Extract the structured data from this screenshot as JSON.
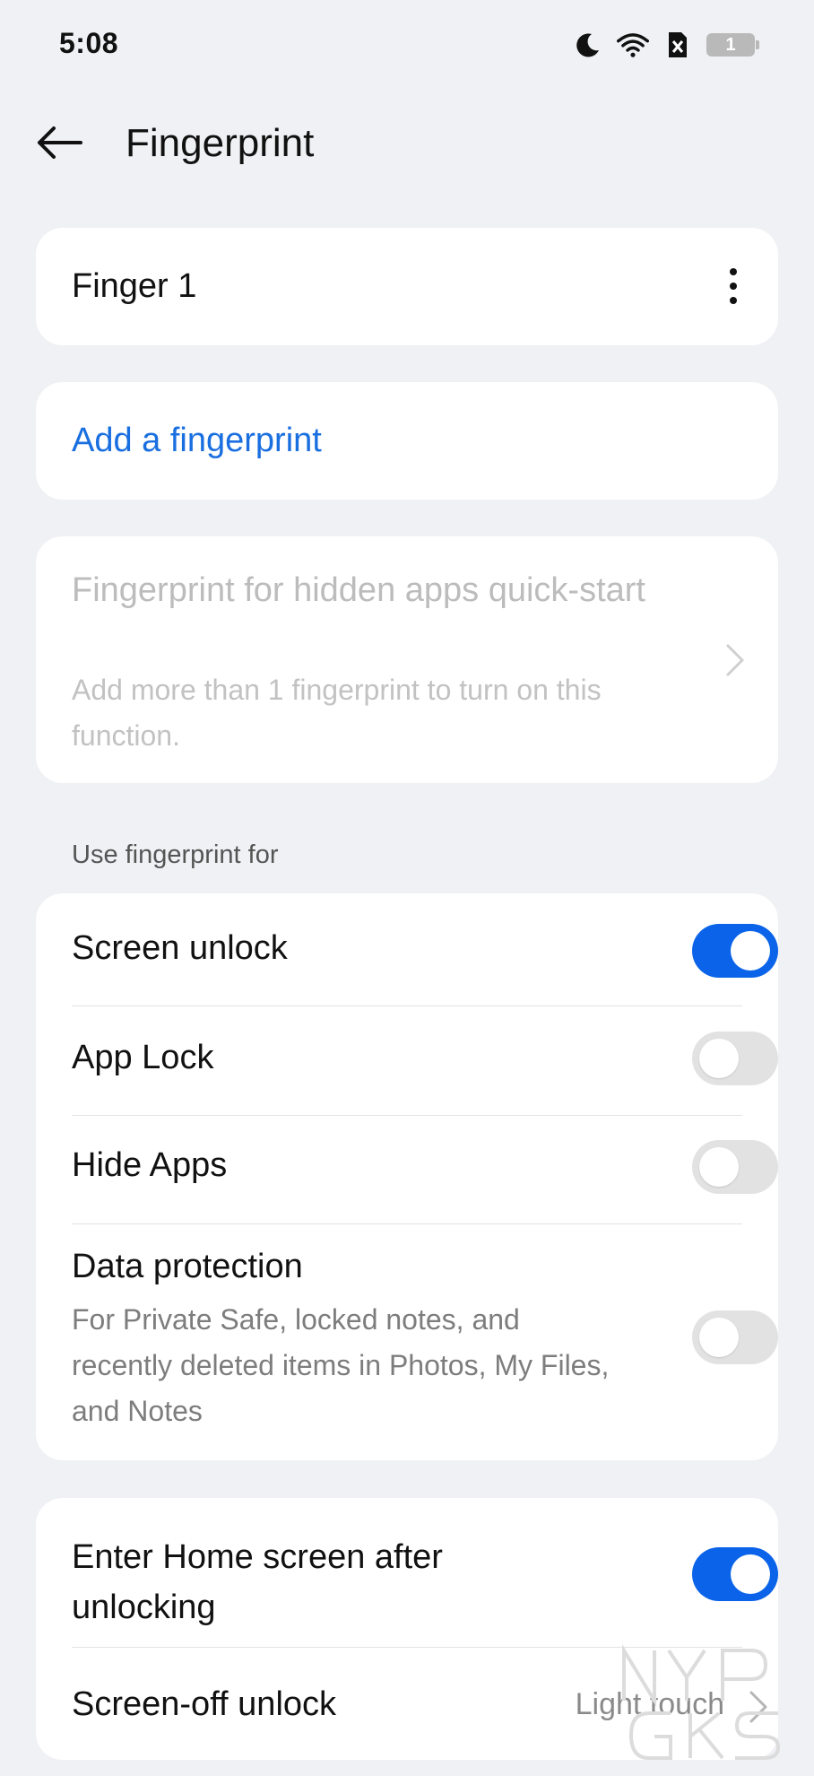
{
  "status_bar": {
    "time": "5:08",
    "icons": [
      "moon-icon",
      "wifi-icon",
      "sim-none-icon"
    ],
    "battery_level": "1"
  },
  "header": {
    "title": "Fingerprint"
  },
  "fingerprints": [
    {
      "label": "Finger 1"
    }
  ],
  "add_fingerprint": {
    "label": "Add a fingerprint"
  },
  "hidden_apps": {
    "title": "Fingerprint for hidden apps quick-start",
    "subtitle": "Add more than 1 fingerprint to turn on this function.",
    "enabled": false
  },
  "use_section": {
    "label": "Use fingerprint for",
    "items": [
      {
        "label": "Screen unlock",
        "on": true
      },
      {
        "label": "App Lock",
        "on": false
      },
      {
        "label": "Hide Apps",
        "on": false
      },
      {
        "label": "Data protection",
        "subtitle": "For Private Safe, locked notes, and recently deleted items in Photos, My Files, and Notes",
        "on": false
      }
    ]
  },
  "extra_section": {
    "items": [
      {
        "label": "Enter Home screen after unlocking",
        "on": true
      },
      {
        "label": "Screen-off unlock",
        "value": "Light touch"
      }
    ]
  },
  "colors": {
    "accent": "#0a63e8",
    "link": "#1a6fe0",
    "background": "#f0f1f4"
  }
}
